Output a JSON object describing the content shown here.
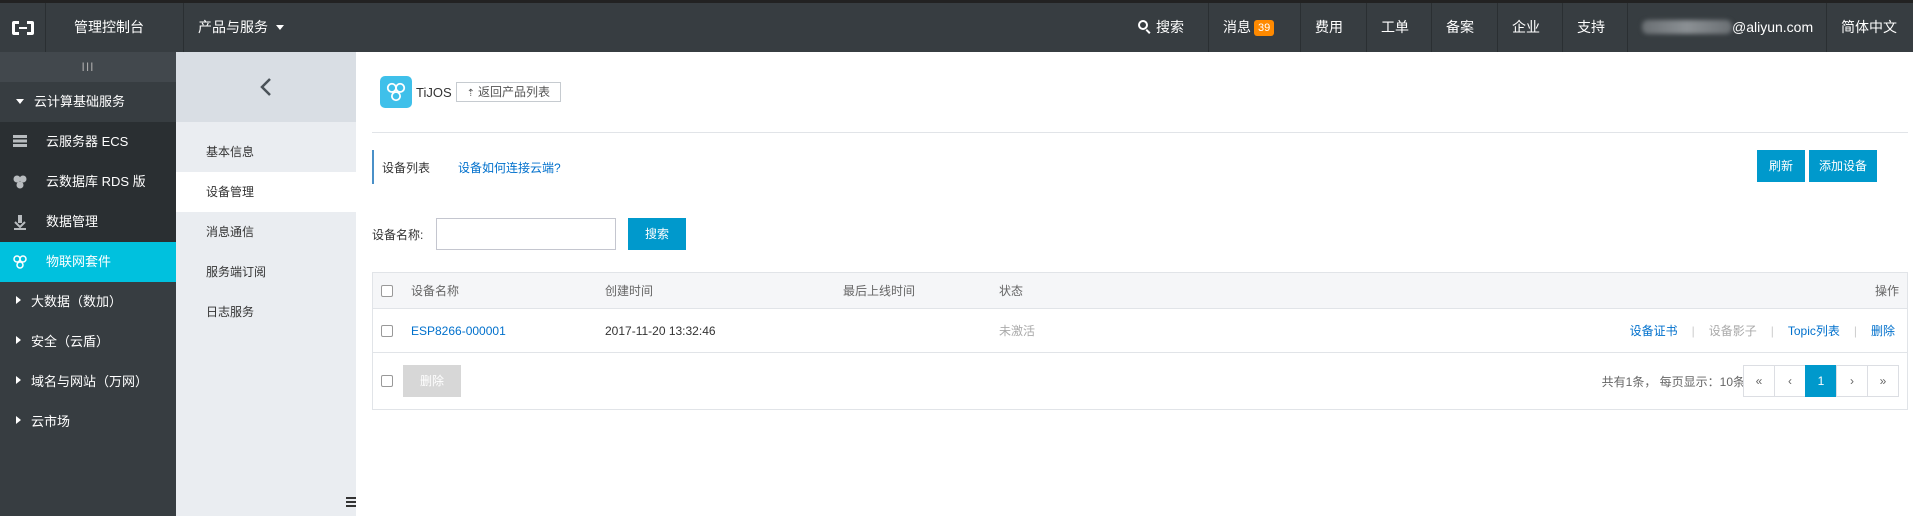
{
  "topbar": {
    "console": "管理控制台",
    "products": "产品与服务",
    "search": "搜索",
    "messages": "消息",
    "message_count": "39",
    "billing": "费用",
    "ticket": "工单",
    "filing": "备案",
    "enterprise": "企业",
    "support": "支持",
    "account": "@aliyun.com",
    "language": "简体中文"
  },
  "sidebar": {
    "toggle": "III",
    "section": "云计算基础服务",
    "items": [
      {
        "label": "云服务器 ECS",
        "icon": "server-icon"
      },
      {
        "label": "云数据库 RDS 版",
        "icon": "database-icon"
      },
      {
        "label": "数据管理",
        "icon": "data-management-icon"
      },
      {
        "label": "物联网套件",
        "icon": "iot-icon"
      }
    ],
    "groups": [
      "大数据（数加）",
      "安全（云盾）",
      "域名与网站（万网）",
      "云市场"
    ]
  },
  "subnav": {
    "items": [
      "基本信息",
      "设备管理",
      "消息通信",
      "服务端订阅",
      "日志服务"
    ],
    "active_index": 1
  },
  "product": {
    "name": "TiJOS",
    "back_label": "返回产品列表"
  },
  "tabs": {
    "device_list": "设备列表",
    "help_link": "设备如何连接云端?"
  },
  "actions": {
    "refresh": "刷新",
    "add_device": "添加设备"
  },
  "search": {
    "label": "设备名称:",
    "value": "",
    "button": "搜索"
  },
  "table": {
    "columns": [
      "设备名称",
      "创建时间",
      "最后上线时间",
      "状态",
      "操作"
    ],
    "rows": [
      {
        "name": "ESP8266-000001",
        "created": "2017-11-20 13:32:46",
        "last_online": "",
        "status": "未激活",
        "ops": [
          "设备证书",
          "设备影子",
          "Topic列表",
          "删除"
        ]
      }
    ],
    "bulk_delete": "删除",
    "summary": "共有1条， 每页显示：10条",
    "pager": {
      "first": "«",
      "prev": "‹",
      "current": "1",
      "next": "›",
      "last": "»"
    }
  },
  "colors": {
    "topbar": "#373d41",
    "active_nav": "#00c1de",
    "primary": "#0099cc",
    "badge": "#ff8a00",
    "link": "#0070cc"
  }
}
